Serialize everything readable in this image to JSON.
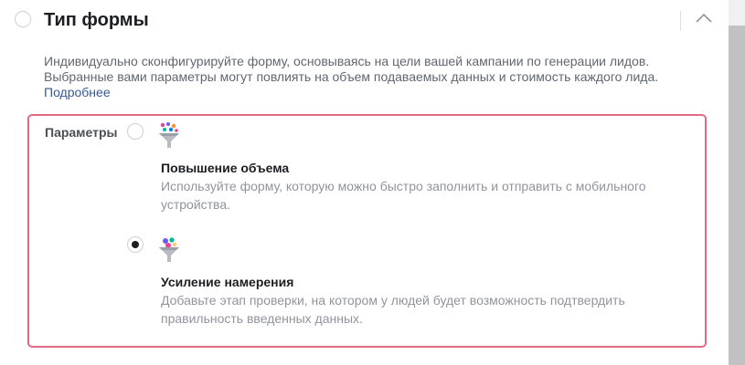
{
  "section": {
    "title": "Тип формы",
    "description": "Индивидуально сконфигурируйте форму, основываясь на цели вашей кампании по генерации лидов. Выбранные вами параметры могут повлиять на объем подаваемых данных и стоимость каждого лида.",
    "learn_more": "Подробнее",
    "collapse_icon": "chevron-up-icon"
  },
  "options": {
    "label": "Параметры",
    "items": [
      {
        "title": "Повышение объема",
        "description": "Используйте форму, которую можно быстро заполнить и отправить с мобильного устройства.",
        "selected": false,
        "icon": "funnel-icon"
      },
      {
        "title": "Усиление намерения",
        "description": "Добавьте этап проверки, на котором у людей будет возможность подтвердить правильность введенных данных.",
        "selected": true,
        "icon": "funnel-icon"
      }
    ]
  },
  "colors": {
    "highlight_border": "#e26b84",
    "link": "#365899",
    "secondary_text": "#90949c"
  }
}
